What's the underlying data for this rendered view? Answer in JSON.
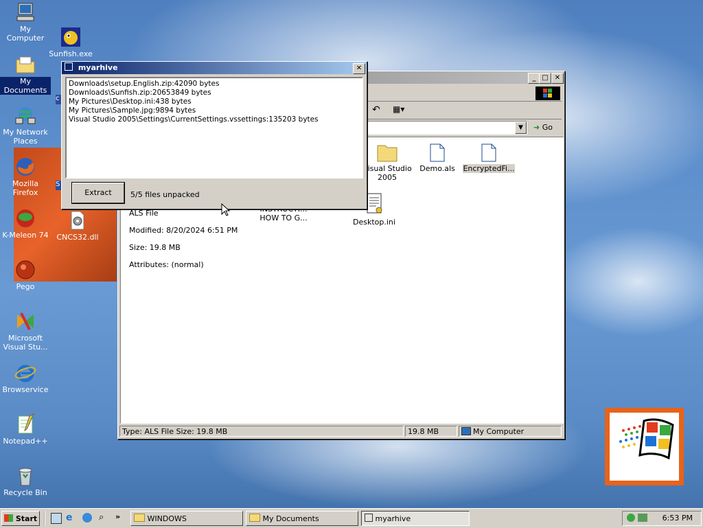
{
  "desktop": {
    "icons": [
      {
        "label": "My Computer",
        "icon": "computer-icon"
      },
      {
        "label": "Sunfish.exe",
        "icon": "fish-icon"
      },
      {
        "label": "My Documents",
        "icon": "folder-icon"
      },
      {
        "label": "My Network Places",
        "icon": "network-icon"
      },
      {
        "label": "Mozilla Firefox",
        "icon": "firefox-icon"
      },
      {
        "label": "K-Meleon 74",
        "icon": "kmeleon-icon"
      },
      {
        "label": "CNCS32.dll",
        "icon": "gear-icon"
      },
      {
        "label": "Pego",
        "icon": "pego-icon"
      },
      {
        "label": "Microsoft Visual Stu...",
        "icon": "visual-studio-icon"
      },
      {
        "label": "Browservice",
        "icon": "ie-icon"
      },
      {
        "label": "Notepad++",
        "icon": "notepad-icon"
      },
      {
        "label": "Recycle Bin",
        "icon": "recycle-bin-icon"
      }
    ]
  },
  "dialog": {
    "title": "myarhive",
    "files": [
      "Downloads\\setup.English.zip:42090 bytes",
      "Downloads\\Sunfish.zip:20653849 bytes",
      "My Pictures\\Desktop.ini:438 bytes",
      "My Pictures\\Sample.jpg:9894 bytes",
      "Visual Studio 2005\\Settings\\CurrentSettings.vssettings:135203 bytes"
    ],
    "extract_label": "Extract",
    "status": "5/5 files unpacked",
    "close_glyph": "✕"
  },
  "explorer": {
    "go_label": "Go",
    "details": {
      "type": "ALS File",
      "modified": "Modified: 8/20/2024 6:51 PM",
      "size": "Size: 19.8 MB",
      "attributes": "Attributes: (normal)"
    },
    "files": [
      {
        "label": "Visual Studio 2005",
        "icon": "folder-icon"
      },
      {
        "label": "Demo.als",
        "icon": "als-file-icon"
      },
      {
        "label": "EncryptedFi...",
        "icon": "encrypted-file-icon"
      },
      {
        "label": "INSTRUCTI... HOW TO G...",
        "icon": "text-file-icon"
      },
      {
        "label": "Desktop.ini",
        "icon": "ini-file-icon"
      }
    ],
    "status": {
      "left": "Type: ALS File Size: 19.8 MB",
      "size": "19.8 MB",
      "zone": "My Computer"
    }
  },
  "taskbar": {
    "start": "Start",
    "tasks": [
      "WINDOWS",
      "My Documents",
      "myarhive"
    ],
    "clock": "6:53 PM",
    "quicklaunch_more": "»"
  },
  "colors": {
    "titlebar_active": "#0a246a",
    "selection": "#0a246a",
    "face": "#d4d0c8"
  }
}
